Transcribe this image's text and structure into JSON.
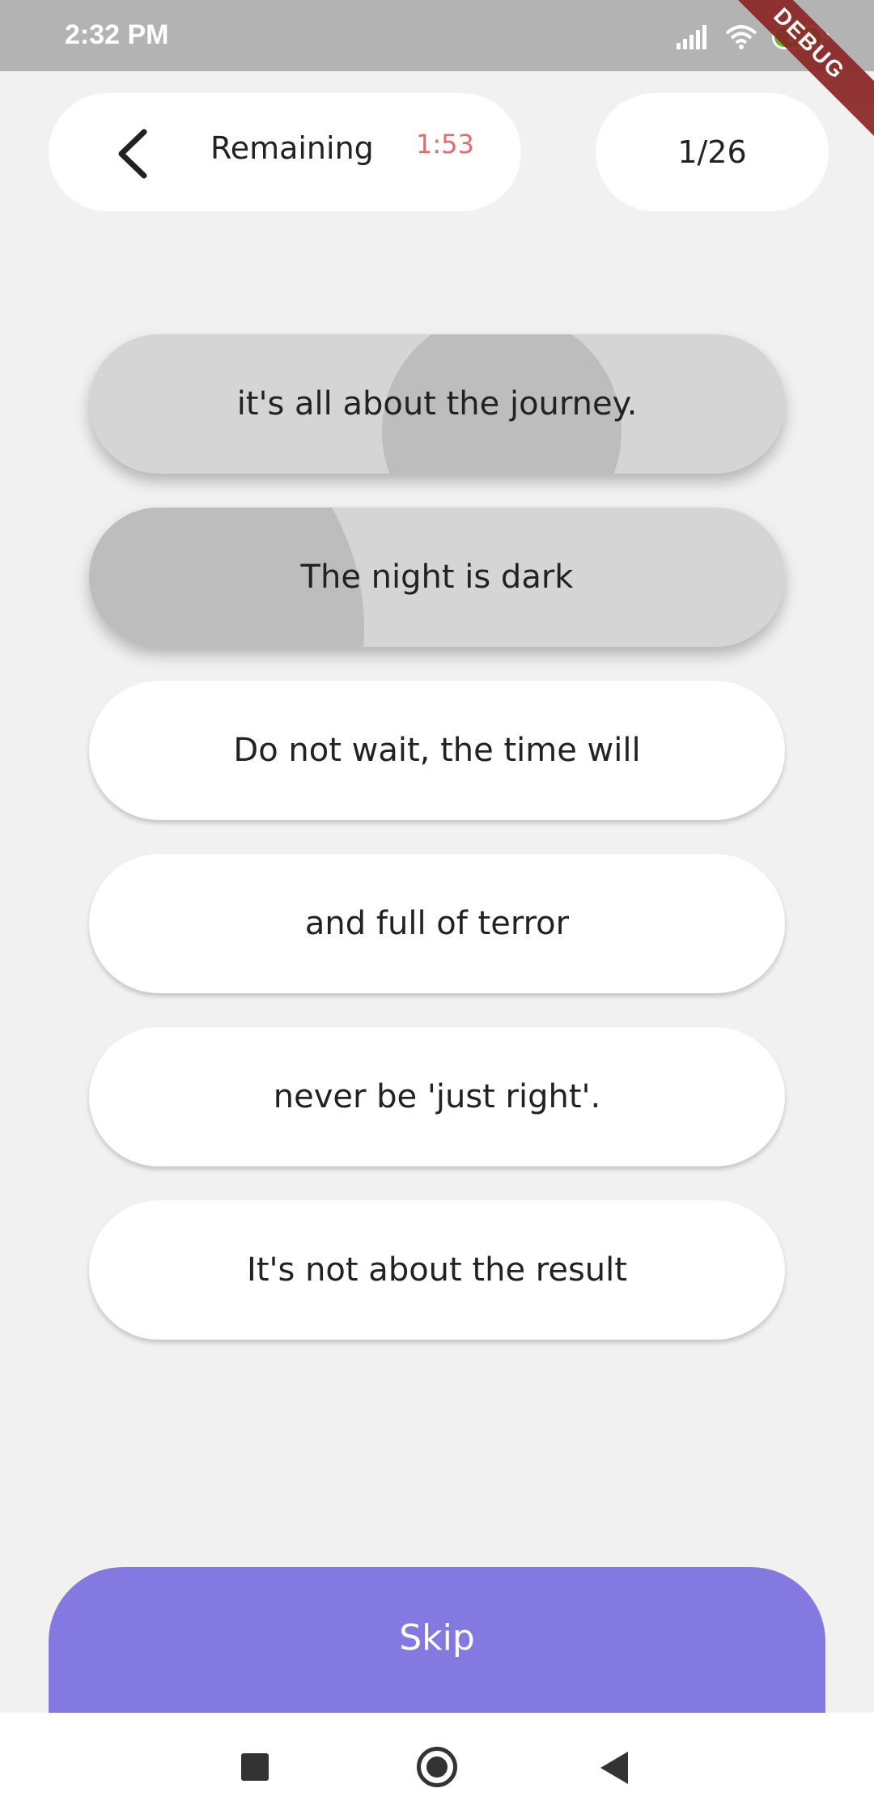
{
  "status_bar": {
    "time": "2:32 PM",
    "battery": "100",
    "debug_label": "DEBUG"
  },
  "header": {
    "remaining_label": "Remaining",
    "remaining_time": "1:53",
    "counter": "1/26"
  },
  "options": [
    {
      "label": "it's all about the journey.",
      "state": "pressed"
    },
    {
      "label": "The night is dark",
      "state": "pressed"
    },
    {
      "label": "Do not wait, the time will",
      "state": "normal"
    },
    {
      "label": "and full of terror",
      "state": "normal"
    },
    {
      "label": "never be 'just right'.",
      "state": "normal"
    },
    {
      "label": "It's not about the result",
      "state": "normal"
    }
  ],
  "skip_label": "Skip",
  "colors": {
    "accent": "#8479e1",
    "timer": "#e36b6b",
    "background": "#f1f1f1",
    "status_bar": "#b3b3b3"
  }
}
